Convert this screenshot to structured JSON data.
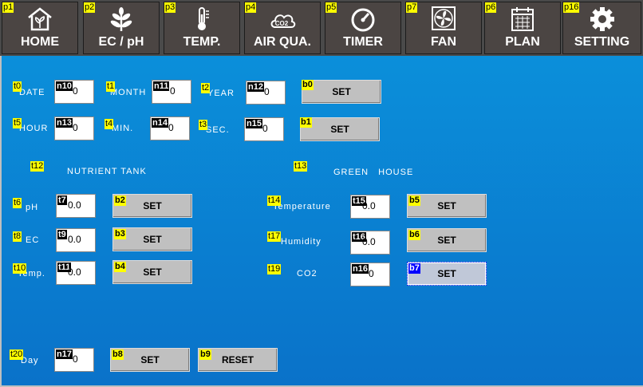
{
  "nav": {
    "tabs": [
      {
        "tag": "p1",
        "label": "HOME",
        "icon": "house-plant-icon"
      },
      {
        "tag": "p2",
        "label": "EC / pH",
        "icon": "leaf-icon"
      },
      {
        "tag": "p3",
        "label": "TEMP.",
        "icon": "thermometer-icon"
      },
      {
        "tag": "p4",
        "label": "AIR QUA.",
        "icon": "co2-cloud-icon"
      },
      {
        "tag": "p5",
        "label": "TIMER",
        "icon": "gauge-icon"
      },
      {
        "tag": "p7",
        "label": "FAN",
        "icon": "fan-icon"
      },
      {
        "tag": "p6",
        "label": "PLAN",
        "icon": "calendar-icon"
      },
      {
        "tag": "p16",
        "label": "SETTING",
        "icon": "gear-icon"
      }
    ]
  },
  "datetime": {
    "date": {
      "tag": "t0",
      "label": "DATE",
      "field_tag": "n10",
      "value": "0"
    },
    "month": {
      "tag": "t1",
      "label": "MONTH",
      "field_tag": "n11",
      "value": "0"
    },
    "year": {
      "tag": "t2",
      "label": "YEAR",
      "field_tag": "n12",
      "value": "0"
    },
    "set1": {
      "tag": "b0",
      "label": "SET"
    },
    "hour": {
      "tag": "t5",
      "label": "HOUR",
      "field_tag": "n13",
      "value": "0"
    },
    "min": {
      "tag": "t4",
      "label": "MIN.",
      "field_tag": "n14",
      "value": "0"
    },
    "sec": {
      "tag": "t3",
      "label": "SEC.",
      "field_tag": "n15",
      "value": "0"
    },
    "set2": {
      "tag": "b1",
      "label": "SET"
    }
  },
  "nutrient": {
    "heading_tag": "t12",
    "heading": "NUTRIENT TANK",
    "ph": {
      "tag": "t6",
      "label": "pH",
      "field_tag": "t7",
      "value": "0.0",
      "btn_tag": "b2",
      "btn": "SET"
    },
    "ec": {
      "tag": "t8",
      "label": "EC",
      "field_tag": "t9",
      "value": "0.0",
      "btn_tag": "b3",
      "btn": "SET"
    },
    "temp": {
      "tag": "t10",
      "label": "Temp.",
      "field_tag": "t11",
      "value": "0.0",
      "btn_tag": "b4",
      "btn": "SET"
    }
  },
  "greenhouse": {
    "heading_tag": "t13",
    "heading": "GREEN HOUSE",
    "temperature": {
      "tag": "t14",
      "label": "Temperature",
      "field_tag": "t15",
      "value": "0.0",
      "btn_tag": "b5",
      "btn": "SET"
    },
    "humidity": {
      "tag": "t17",
      "label": "Humidity",
      "field_tag": "t16",
      "value": "0.0",
      "btn_tag": "b6",
      "btn": "SET"
    },
    "co2": {
      "tag": "t19",
      "label": "CO2",
      "field_tag": "n16",
      "value": "0",
      "btn_tag": "b7",
      "btn": "SET"
    }
  },
  "day": {
    "tag": "t20",
    "label": "Day",
    "field_tag": "n17",
    "value": "0",
    "set_tag": "b8",
    "set": "SET",
    "reset_tag": "b9",
    "reset": "RESET"
  }
}
